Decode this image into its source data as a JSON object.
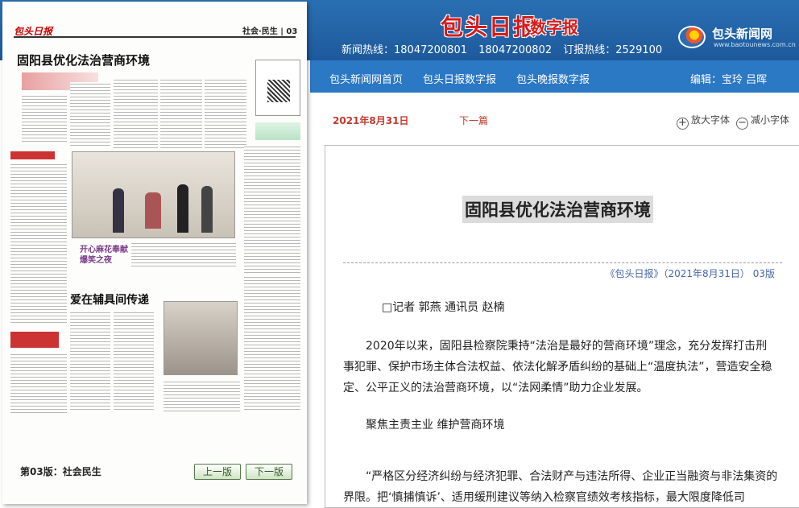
{
  "header": {
    "logo_text": "包头日报",
    "logo_sub": "数字报",
    "hotlines": [
      "新闻热线：18047200801",
      "18047200802",
      "订报热线：2529100"
    ],
    "site_name": "包头新闻网",
    "site_url": "www.baotounews.com.cn"
  },
  "nav": {
    "links": [
      "包头新闻网首页",
      "包头日报数字报",
      "包头晚报数字报"
    ],
    "editor": "编辑：宝玲 吕晖"
  },
  "toolbar": {
    "date": "2021年8月31日",
    "next_label": "下一篇",
    "zoom_in": "放大字体",
    "zoom_out": "减小字体"
  },
  "paper": {
    "masthead": "包头日报",
    "section": "社会·民生 | 03",
    "headline": "固阳县优化法治营商环境",
    "subhead_1": "开心麻花奉献爆笑之夜",
    "subhead_2": "爱在辅具间传递",
    "page_label": "第03版：社会民生",
    "prev_button": "上一版",
    "next_button": "下一版"
  },
  "article": {
    "title": "固阳县优化法治营商环境",
    "source": "《包头日报》（2021年8月31日） 03版",
    "paragraphs": [
      "□记者 郭燕 通讯员 赵楠",
      "2020年以来，固阳县检察院秉持“法治是最好的营商环境”理念，充分发挥打击刑事犯罪、保护市场主体合法权益、依法化解矛盾纠纷的基础上“温度执法”，营造安全稳定、公平正义的法治营商环境，以“法网柔情”助力企业发展。",
      "聚焦主责主业 维护营商环境",
      "“严格区分经济纠纷与经济犯罪、合法财产与违法所得、企业正当融资与非法集资的界限。把‘慎捕慎诉’、适用缓刑建议等纳入检察官绩效考核指标，最大限度降低司"
    ]
  },
  "colors": {
    "header_blue": "#1d5a9c",
    "nav_blue": "#2b78c5",
    "date_red": "#c0392b",
    "logo_red": "#d71b1b"
  }
}
